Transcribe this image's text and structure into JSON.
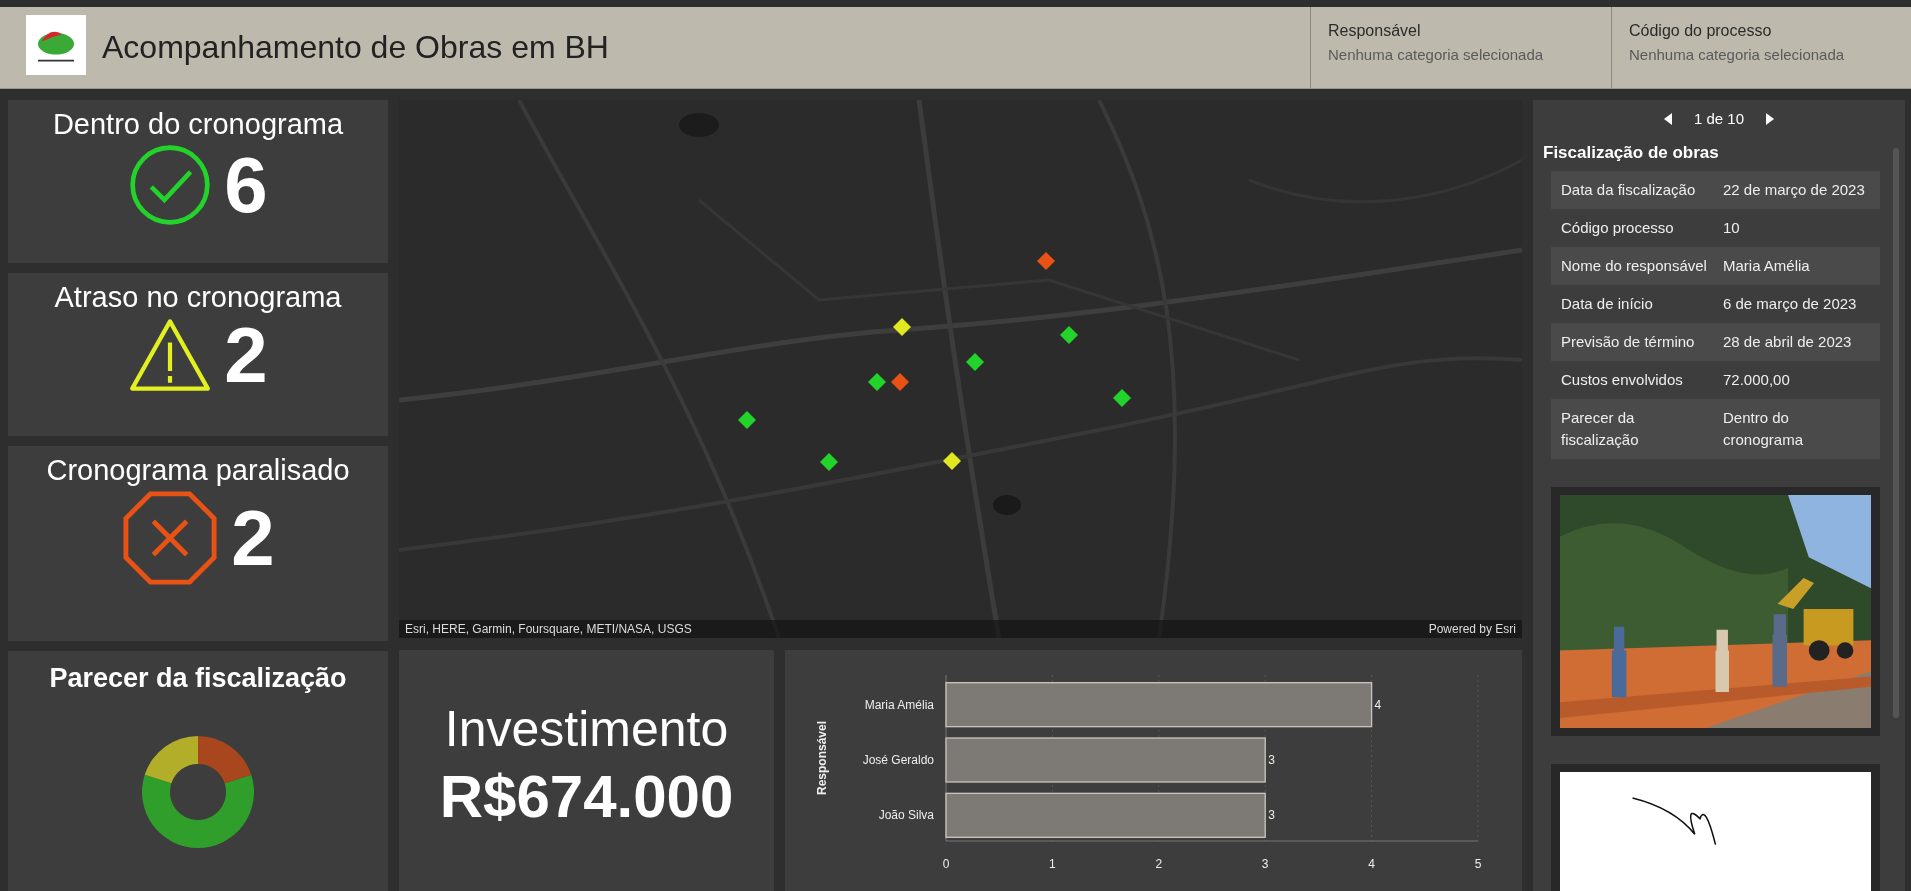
{
  "header": {
    "title": "Acompanhamento de Obras em BH",
    "filters": [
      {
        "label": "Responsável",
        "placeholder": "Nenhuma categoria selecionada"
      },
      {
        "label": "Código do processo",
        "placeholder": "Nenhuma categoria selecionada"
      }
    ]
  },
  "kpis": [
    {
      "kind": "check",
      "title": "Dentro do cronograma",
      "value": "6",
      "color": "#22d42a"
    },
    {
      "kind": "warning",
      "title": "Atraso no cronograma",
      "value": "2",
      "color": "#e2f020"
    },
    {
      "kind": "stop",
      "title": "Cronograma paralisado",
      "value": "2",
      "color": "#e85214"
    }
  ],
  "donut": {
    "title": "Parecer da fiscalização",
    "slices": [
      {
        "color": "#2f9e2a"
      },
      {
        "color": "#b2ae2a"
      },
      {
        "color": "#a8461e"
      }
    ]
  },
  "map": {
    "attribution": "Esri, HERE, Garmin, Foursquare, METI/NASA, USGS",
    "powered_by": "Powered by Esri",
    "markers": [
      {
        "color": "#e85214"
      },
      {
        "color": "#e2e820"
      },
      {
        "color": "#22d42a"
      },
      {
        "color": "#22d42a"
      },
      {
        "color": "#22d42a"
      },
      {
        "color": "#e85214"
      },
      {
        "color": "#22d42a"
      },
      {
        "color": "#22d42a"
      },
      {
        "color": "#22d42a"
      },
      {
        "color": "#e2e820"
      }
    ]
  },
  "investment": {
    "label": "Investimento",
    "value": "R$674.000"
  },
  "bar_chart": {
    "chart_data": {
      "type": "bar",
      "orientation": "horizontal",
      "ylabel": "Responsável",
      "categories": [
        "Maria Amélia",
        "José Geraldo",
        "João Silva"
      ],
      "values": [
        4,
        3,
        3
      ],
      "xlim": [
        0,
        5
      ],
      "xticks": [
        0,
        1,
        2,
        3,
        4,
        5
      ],
      "grid": true,
      "data_labels": true
    }
  },
  "details": {
    "pager": "1 de 10",
    "title": "Fiscalização de obras",
    "rows": [
      {
        "label": "Data da fiscalização",
        "value": "22 de março de 2023"
      },
      {
        "label": "Código processo",
        "value": "10"
      },
      {
        "label": "Nome do responsável",
        "value": "Maria Amélia"
      },
      {
        "label": "Data de início",
        "value": "6 de março de 2023"
      },
      {
        "label": "Previsão de término",
        "value": "28 de abril de 2023"
      },
      {
        "label": "Custos envolvidos",
        "value": "72.000,00"
      },
      {
        "label": "Parecer da fiscalização",
        "value": "Dentro do cronograma"
      }
    ]
  }
}
